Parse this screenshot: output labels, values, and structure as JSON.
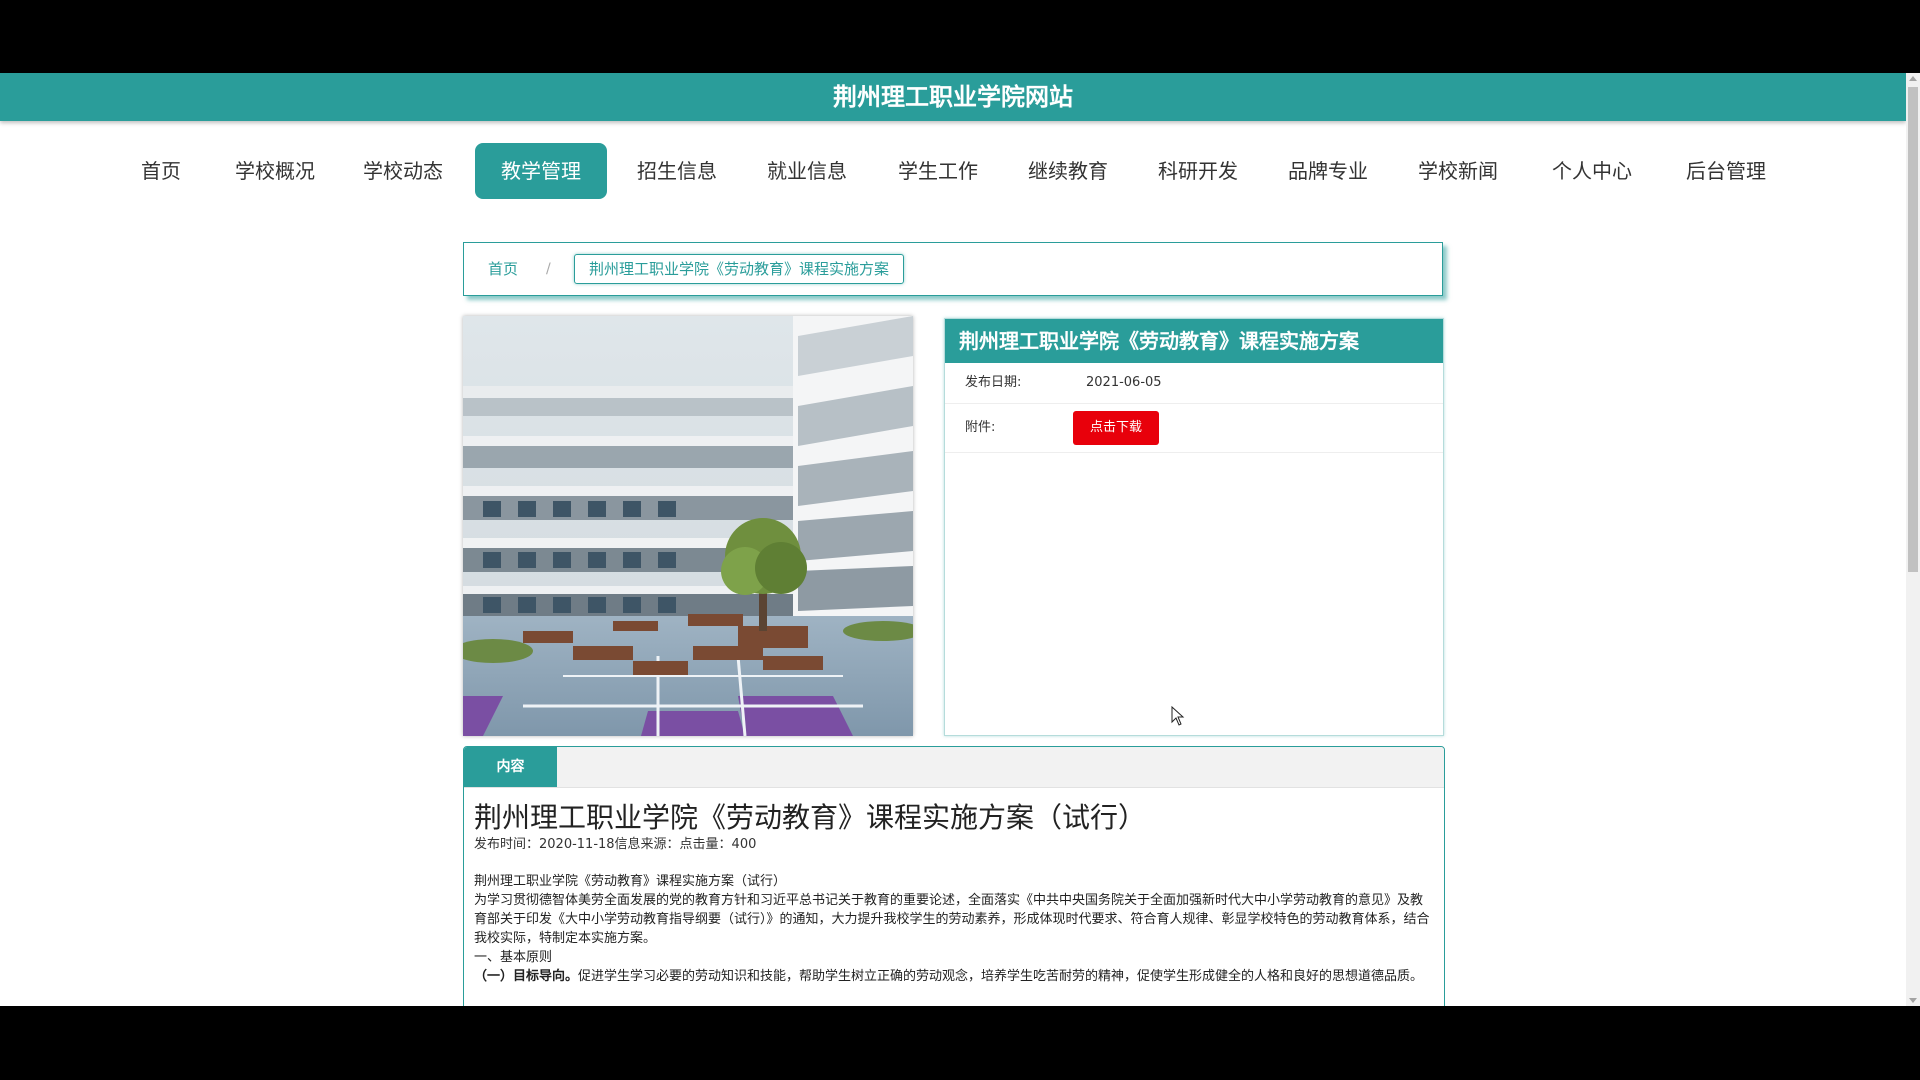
{
  "site": {
    "title": "荆州理工职业学院网站"
  },
  "nav": {
    "items": [
      {
        "label": "首页",
        "active": false
      },
      {
        "label": "学校概况",
        "active": false
      },
      {
        "label": "学校动态",
        "active": false
      },
      {
        "label": "教学管理",
        "active": true
      },
      {
        "label": "招生信息",
        "active": false
      },
      {
        "label": "就业信息",
        "active": false
      },
      {
        "label": "学生工作",
        "active": false
      },
      {
        "label": "继续教育",
        "active": false
      },
      {
        "label": "科研开发",
        "active": false
      },
      {
        "label": "品牌专业",
        "active": false
      },
      {
        "label": "学校新闻",
        "active": false
      },
      {
        "label": "个人中心",
        "active": false
      },
      {
        "label": "后台管理",
        "active": false
      }
    ]
  },
  "breadcrumb": {
    "home": "首页",
    "separator": "/",
    "current": "荆州理工职业学院《劳动教育》课程实施方案"
  },
  "info": {
    "title": "荆州理工职业学院《劳动教育》课程实施方案",
    "date_label": "发布日期:",
    "date_value": "2021-06-05",
    "attachment_label": "附件:",
    "download_label": "点击下载"
  },
  "content": {
    "tab_label": "内容",
    "article_title": "荆州理工职业学院《劳动教育》课程实施方案（试行）",
    "meta": "发布时间：2020-11-18信息来源：点击量：400",
    "paragraphs": [
      "荆州理工职业学院《劳动教育》课程实施方案（试行）",
      "为学习贯彻德智体美劳全面发展的党的教育方针和习近平总书记关于教育的重要论述，全面落实《中共中央国务院关于全面加强新时代大中小学劳动教育的意见》及教育部关于印发《大中小学劳动教育指导纲要（试行）》的通知，大力提升我校学生的劳动素养，形成体现时代要求、符合育人规律、彰显学校特色的劳动教育体系，结合我校实际，特制定本实施方案。",
      "一、基本原则"
    ],
    "principle_heading": "（一）目标导向。",
    "principle_text": "促进学生学习必要的劳动知识和技能，帮助学生树立正确的劳动观念，培养学生吃苦耐劳的精神，促使学生形成健全的人格和良好的思想道德品质。"
  },
  "colors": {
    "brand": "#2a9d9a",
    "download": "#e8000b"
  }
}
